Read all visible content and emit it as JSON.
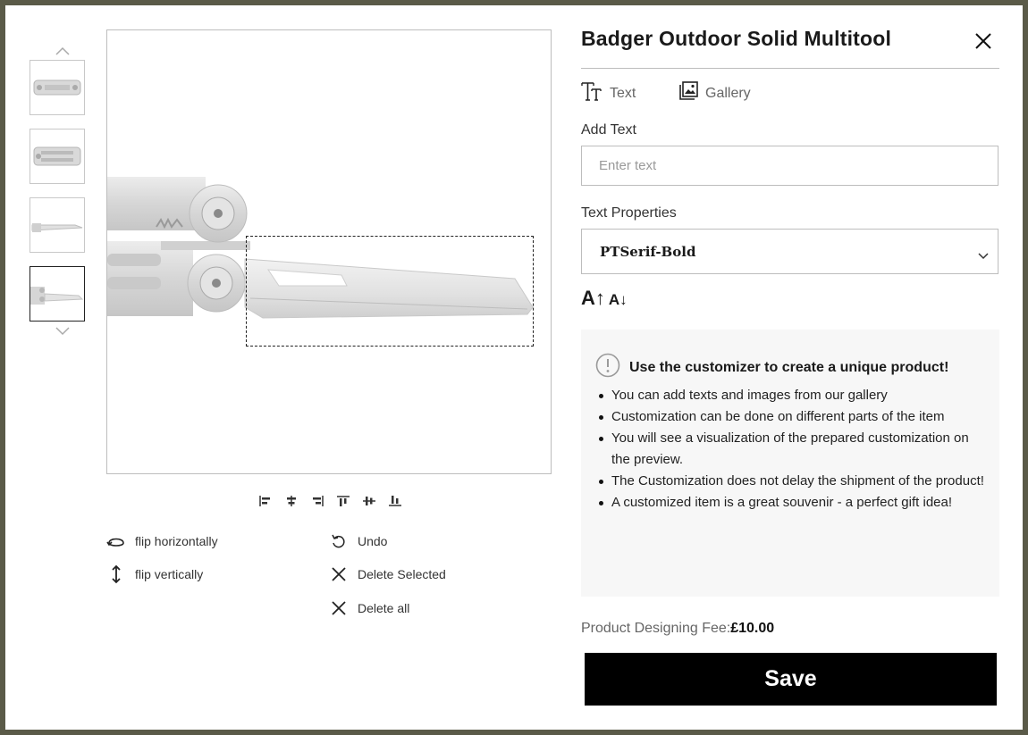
{
  "product": {
    "title": "Badger Outdoor Solid Multitool"
  },
  "tabs": [
    {
      "label": "Text",
      "icon": "text-icon"
    },
    {
      "label": "Gallery",
      "icon": "gallery-icon"
    }
  ],
  "text_panel": {
    "add_text_label": "Add Text",
    "input_placeholder": "Enter text",
    "input_value": "",
    "properties_label": "Text Properties",
    "font_value": "PTSerif-Bold",
    "increase_size_label": "A↑",
    "decrease_size_label": "A↓"
  },
  "info": {
    "heading": "Use the customizer to create a unique product!",
    "items": [
      "You can add texts and images from our gallery",
      "Customization can be done on different parts of the item",
      "You will see a visualization of the prepared customization on the preview.",
      "The Customization does not delay the shipment of the product!",
      "A customized item is a great souvenir - a perfect gift idea!"
    ]
  },
  "fee": {
    "label": "Product Designing Fee:",
    "value": "£10.00"
  },
  "save_label": "Save",
  "tools": {
    "flip_horizontal": "flip horizontally",
    "flip_vertical": "flip vertically",
    "undo": "Undo",
    "delete_selected": "Delete Selected",
    "delete_all": "Delete all"
  },
  "colors": {
    "accent": "#000000",
    "info_bg": "#f7f7f7",
    "backdrop": "#5a5a48"
  }
}
